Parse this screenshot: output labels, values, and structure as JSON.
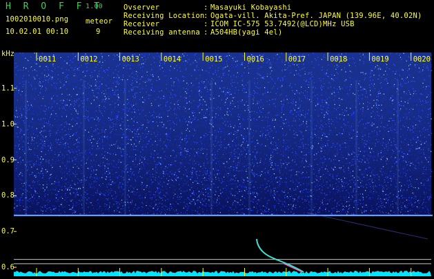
{
  "header": {
    "brand": "H R O F F T",
    "version": "1.00",
    "filename": "1002010010.png",
    "meteor_label": "meteor",
    "meteor_count": "9",
    "datetime": "10.02.01 00:10",
    "info_labels": [
      "Ovserver",
      "Receiving Location",
      "Receiver",
      "Receiving antenna"
    ],
    "info_sep": ":",
    "info_values": [
      "Masayuki Kobayashi",
      "Ogata-vill. Akita-Pref. JAPAN (139.96E, 40.02N)",
      "ICOM IC-575 53.7492(@LCD)MHz USB",
      "A504HB(yagi 4el)"
    ]
  },
  "chart_data": {
    "type": "heatmap",
    "title": "",
    "ylabel": "kHz",
    "x_ticks": [
      "0011",
      "0012",
      "0013",
      "0014",
      "0015",
      "0016",
      "0017",
      "0018",
      "0019",
      "0020"
    ],
    "y_ticks": [
      "1.1",
      "1.0",
      "0.9",
      "0.8",
      "0.7",
      "0.6"
    ],
    "y_tick_values": [
      1.1,
      1.0,
      0.9,
      0.8,
      0.7,
      0.6
    ],
    "ylim": [
      0.575,
      1.2
    ],
    "carrier_khz": 0.745,
    "reference_lines_khz": [
      0.622,
      0.61
    ],
    "colors": {
      "background": "#000000",
      "noise_low": "#0a1466",
      "noise_high": "#2f5bff",
      "speckle": "#9fd0ff",
      "carrier": "#5fb3ff",
      "reference": "#c8c8c8",
      "ticks": "#ffff33",
      "meteor": "#40e0d0",
      "baseline": "#00e5ff"
    }
  }
}
